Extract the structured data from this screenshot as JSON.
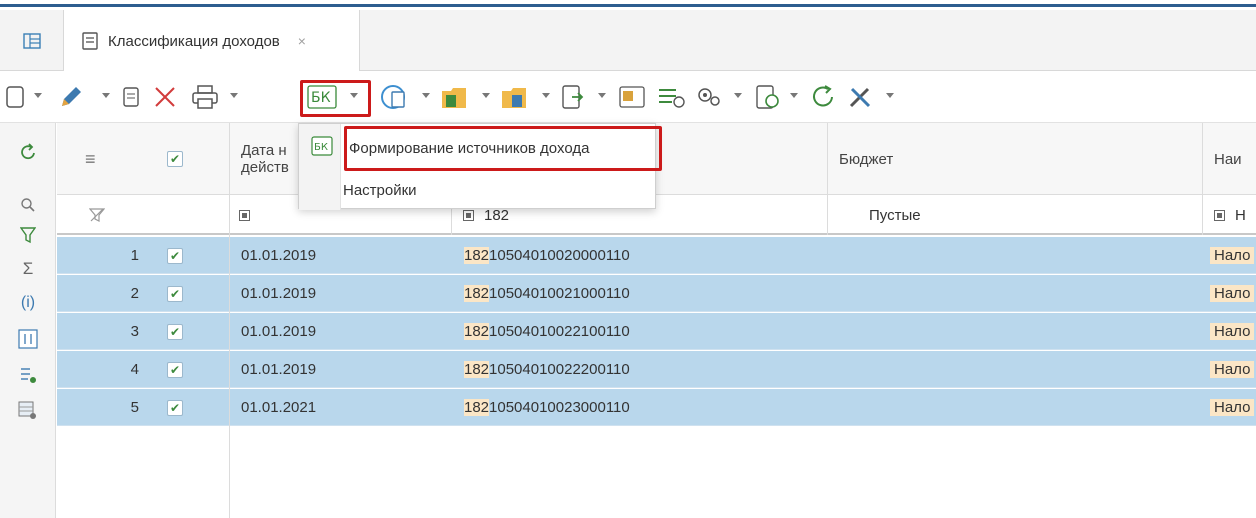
{
  "tabs": {
    "active_label": "Классификация доходов",
    "close_glyph": "×"
  },
  "menu": {
    "items": [
      {
        "label": "Формирование источников дохода",
        "icon": "budget-source-icon"
      },
      {
        "label": "Настройки",
        "icon": ""
      }
    ]
  },
  "grid": {
    "headers": {
      "menu_glyph": "≡",
      "date_line1": "Дата н",
      "date_line2": "действ",
      "budget": "Бюджет",
      "name": "Наи"
    },
    "filter": {
      "code_value": "182",
      "budget_value": "Пустые",
      "name_value": "Н"
    },
    "rows": [
      {
        "n": "1",
        "date": "01.01.2019",
        "code_prefix": "182",
        "code_rest": "10504010020000110",
        "name": "Нало"
      },
      {
        "n": "2",
        "date": "01.01.2019",
        "code_prefix": "182",
        "code_rest": "10504010021000110",
        "name": "Нало"
      },
      {
        "n": "3",
        "date": "01.01.2019",
        "code_prefix": "182",
        "code_rest": "10504010022100110",
        "name": "Нало"
      },
      {
        "n": "4",
        "date": "01.01.2019",
        "code_prefix": "182",
        "code_rest": "10504010022200110",
        "name": "Нало"
      },
      {
        "n": "5",
        "date": "01.01.2021",
        "code_prefix": "182",
        "code_rest": "10504010023000110",
        "name": "Нало"
      }
    ]
  },
  "colors": {
    "row_selected": "#b9d7ec",
    "highlight_red": "#cc1a1a",
    "code_highlight": "#fbe6c6",
    "accent_line": "#2d5d8f"
  }
}
